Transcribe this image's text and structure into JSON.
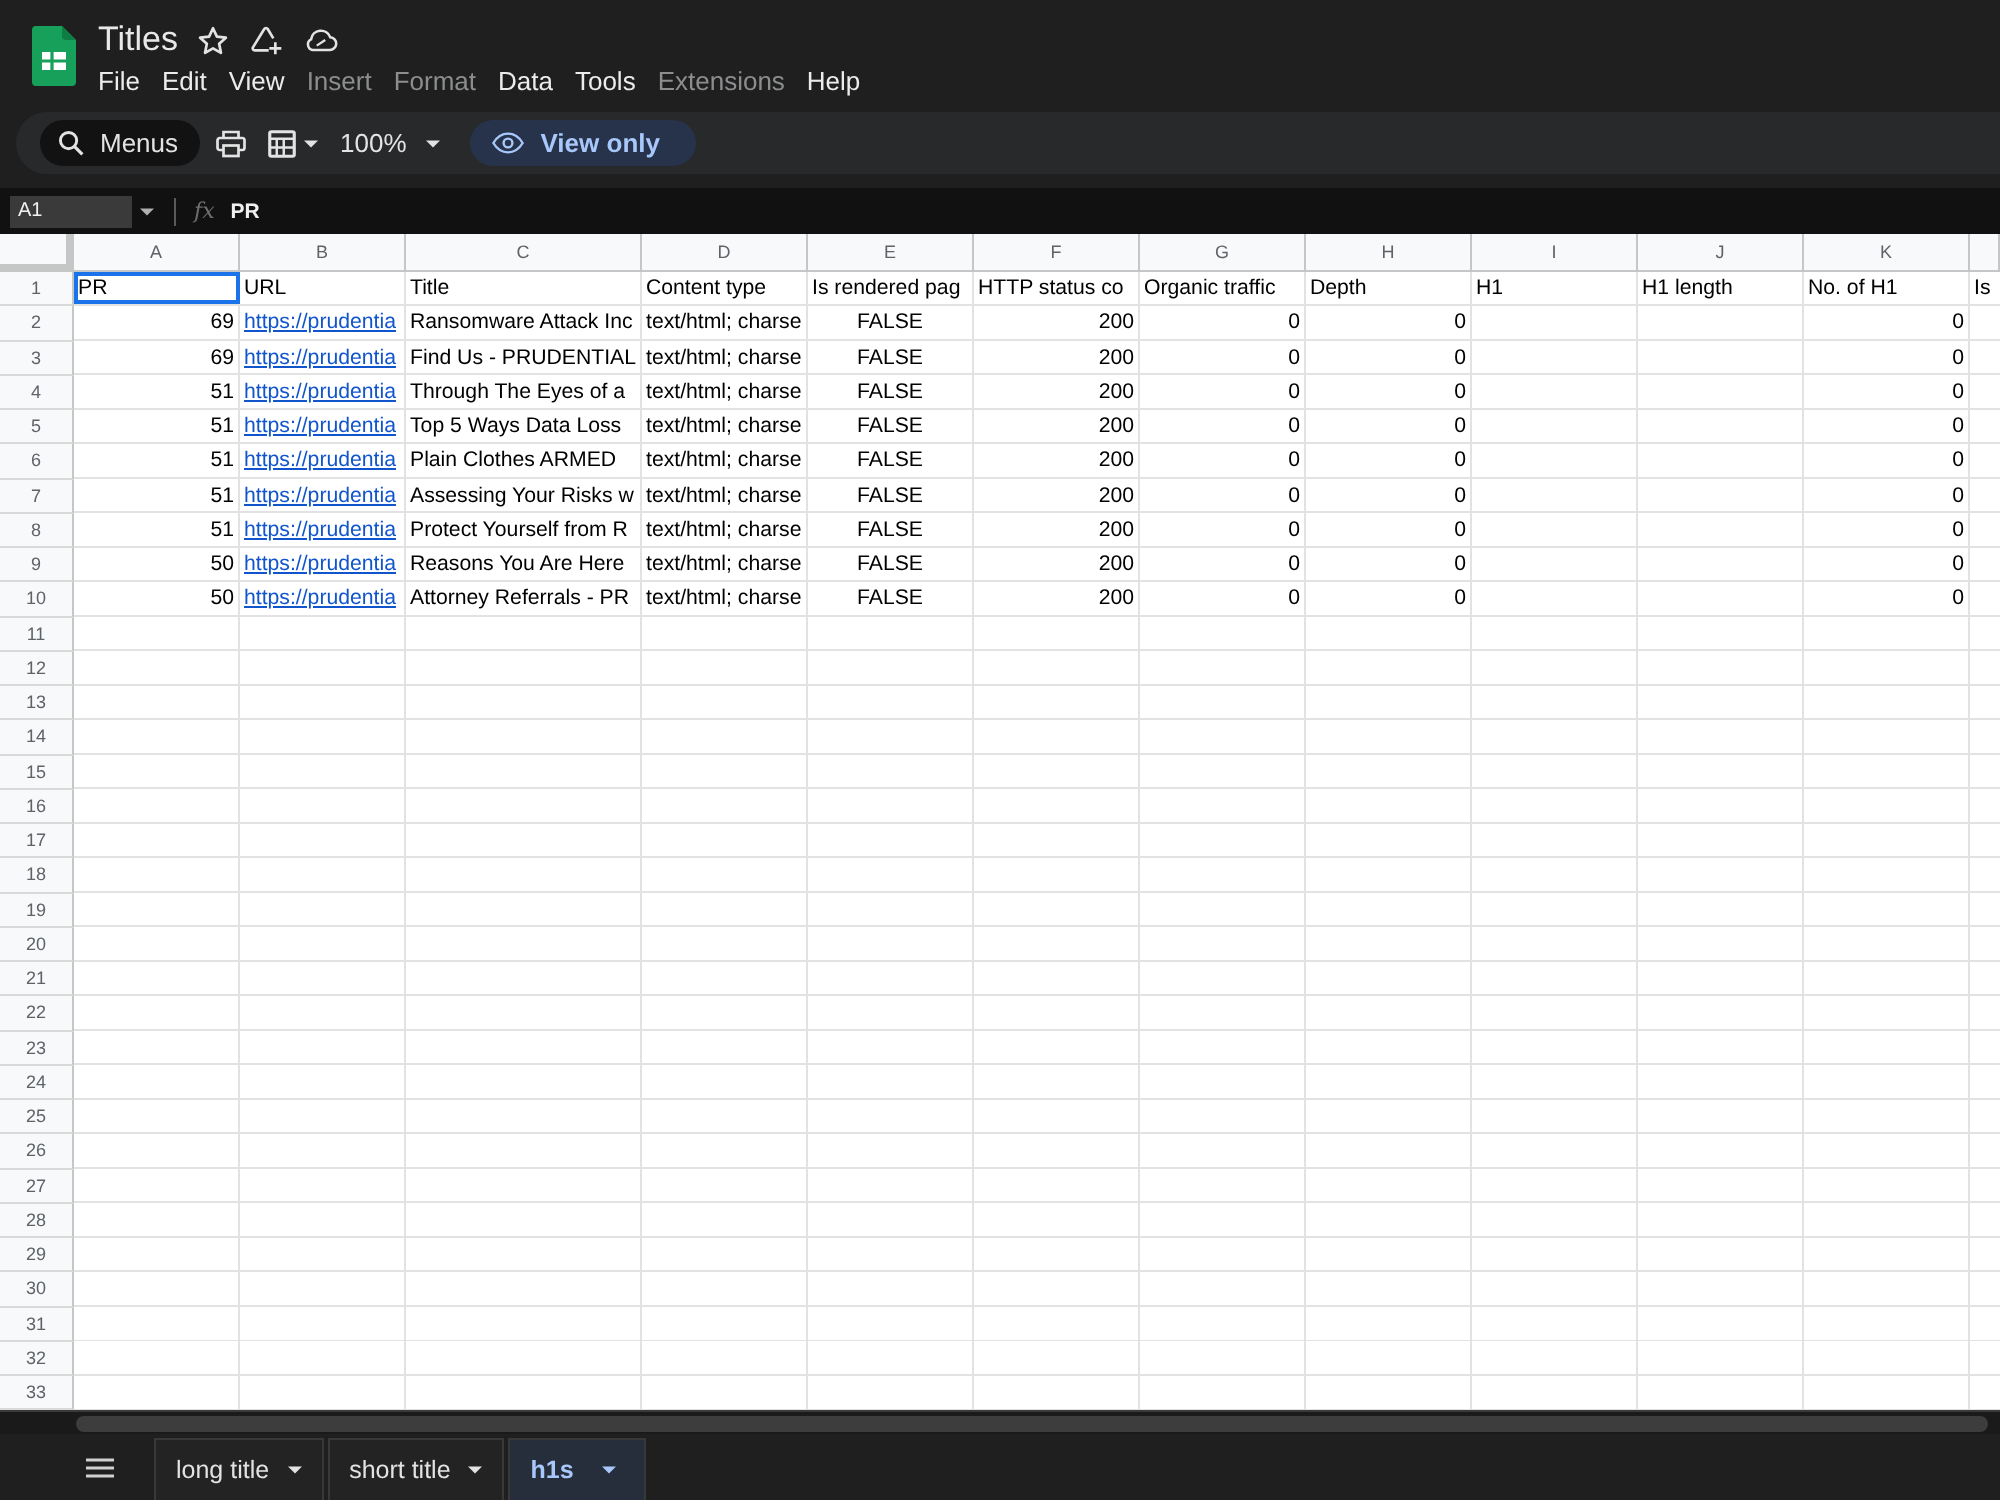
{
  "document": {
    "title": "Titles"
  },
  "menu_bar": [
    {
      "label": "File",
      "disabled": false
    },
    {
      "label": "Edit",
      "disabled": false
    },
    {
      "label": "View",
      "disabled": false
    },
    {
      "label": "Insert",
      "disabled": true
    },
    {
      "label": "Format",
      "disabled": true
    },
    {
      "label": "Data",
      "disabled": false
    },
    {
      "label": "Tools",
      "disabled": false
    },
    {
      "label": "Extensions",
      "disabled": true
    },
    {
      "label": "Help",
      "disabled": false
    }
  ],
  "toolbar": {
    "menus_search": {
      "label": "Menus"
    },
    "zoom": "100%",
    "mode_badge": "View only"
  },
  "formula_bar": {
    "cell_ref": "A1",
    "function_symbol": "fx",
    "content": "PR"
  },
  "sheet": {
    "columns": [
      "A",
      "B",
      "C",
      "D",
      "E",
      "F",
      "G",
      "H",
      "I",
      "J",
      "K"
    ],
    "rows": [
      {
        "number": "1",
        "cells": [
          {
            "text": "PR",
            "kind": "text",
            "selected": true
          },
          {
            "text": "URL",
            "kind": "text",
            "selected": false
          },
          {
            "text": "Title",
            "kind": "text",
            "selected": false
          },
          {
            "text": "Content type",
            "kind": "text",
            "selected": false
          },
          {
            "text": "Is rendered pag",
            "kind": "text",
            "selected": false
          },
          {
            "text": "HTTP status co",
            "kind": "text",
            "selected": false
          },
          {
            "text": "Organic traffic",
            "kind": "text",
            "selected": false
          },
          {
            "text": "Depth",
            "kind": "text",
            "selected": false
          },
          {
            "text": "H1",
            "kind": "text",
            "selected": false
          },
          {
            "text": "H1 length",
            "kind": "text",
            "selected": false
          },
          {
            "text": "No. of H1",
            "kind": "text",
            "selected": false
          },
          {
            "text": "Is",
            "kind": "text",
            "selected": false
          }
        ]
      },
      {
        "number": "2",
        "cells": [
          {
            "text": "69",
            "kind": "number",
            "selected": false
          },
          {
            "text": "https://prudentia",
            "kind": "link",
            "selected": false
          },
          {
            "text": "Ransomware Attack Inc",
            "kind": "text",
            "selected": false
          },
          {
            "text": "text/html; charse",
            "kind": "text",
            "selected": false
          },
          {
            "text": "FALSE",
            "kind": "boolean",
            "selected": false
          },
          {
            "text": "200",
            "kind": "number",
            "selected": false
          },
          {
            "text": "0",
            "kind": "number",
            "selected": false
          },
          {
            "text": "0",
            "kind": "number",
            "selected": false
          },
          {},
          {},
          {
            "text": "0",
            "kind": "number",
            "selected": false
          }
        ]
      },
      {
        "number": "3",
        "cells": [
          {
            "text": "69",
            "kind": "number",
            "selected": false
          },
          {
            "text": "https://prudentia",
            "kind": "link",
            "selected": false
          },
          {
            "text": "Find Us - PRUDENTIAL",
            "kind": "text",
            "selected": false
          },
          {
            "text": "text/html; charse",
            "kind": "text",
            "selected": false
          },
          {
            "text": "FALSE",
            "kind": "boolean",
            "selected": false
          },
          {
            "text": "200",
            "kind": "number",
            "selected": false
          },
          {
            "text": "0",
            "kind": "number",
            "selected": false
          },
          {
            "text": "0",
            "kind": "number",
            "selected": false
          },
          {},
          {},
          {
            "text": "0",
            "kind": "number",
            "selected": false
          }
        ]
      },
      {
        "number": "4",
        "cells": [
          {
            "text": "51",
            "kind": "number",
            "selected": false
          },
          {
            "text": "https://prudentia",
            "kind": "link",
            "selected": false
          },
          {
            "text": "Through The Eyes of a",
            "kind": "text",
            "selected": false
          },
          {
            "text": "text/html; charse",
            "kind": "text",
            "selected": false
          },
          {
            "text": "FALSE",
            "kind": "boolean",
            "selected": false
          },
          {
            "text": "200",
            "kind": "number",
            "selected": false
          },
          {
            "text": "0",
            "kind": "number",
            "selected": false
          },
          {
            "text": "0",
            "kind": "number",
            "selected": false
          },
          {},
          {},
          {
            "text": "0",
            "kind": "number",
            "selected": false
          }
        ]
      },
      {
        "number": "5",
        "cells": [
          {
            "text": "51",
            "kind": "number",
            "selected": false
          },
          {
            "text": "https://prudentia",
            "kind": "link",
            "selected": false
          },
          {
            "text": "Top 5 Ways Data Loss",
            "kind": "text",
            "selected": false
          },
          {
            "text": "text/html; charse",
            "kind": "text",
            "selected": false
          },
          {
            "text": "FALSE",
            "kind": "boolean",
            "selected": false
          },
          {
            "text": "200",
            "kind": "number",
            "selected": false
          },
          {
            "text": "0",
            "kind": "number",
            "selected": false
          },
          {
            "text": "0",
            "kind": "number",
            "selected": false
          },
          {},
          {},
          {
            "text": "0",
            "kind": "number",
            "selected": false
          }
        ]
      },
      {
        "number": "6",
        "cells": [
          {
            "text": "51",
            "kind": "number",
            "selected": false
          },
          {
            "text": "https://prudentia",
            "kind": "link",
            "selected": false
          },
          {
            "text": "Plain Clothes ARMED",
            "kind": "text",
            "selected": false
          },
          {
            "text": "text/html; charse",
            "kind": "text",
            "selected": false
          },
          {
            "text": "FALSE",
            "kind": "boolean",
            "selected": false
          },
          {
            "text": "200",
            "kind": "number",
            "selected": false
          },
          {
            "text": "0",
            "kind": "number",
            "selected": false
          },
          {
            "text": "0",
            "kind": "number",
            "selected": false
          },
          {},
          {},
          {
            "text": "0",
            "kind": "number",
            "selected": false
          }
        ]
      },
      {
        "number": "7",
        "cells": [
          {
            "text": "51",
            "kind": "number",
            "selected": false
          },
          {
            "text": "https://prudentia",
            "kind": "link",
            "selected": false
          },
          {
            "text": "Assessing Your Risks w",
            "kind": "text",
            "selected": false
          },
          {
            "text": "text/html; charse",
            "kind": "text",
            "selected": false
          },
          {
            "text": "FALSE",
            "kind": "boolean",
            "selected": false
          },
          {
            "text": "200",
            "kind": "number",
            "selected": false
          },
          {
            "text": "0",
            "kind": "number",
            "selected": false
          },
          {
            "text": "0",
            "kind": "number",
            "selected": false
          },
          {},
          {},
          {
            "text": "0",
            "kind": "number",
            "selected": false
          }
        ]
      },
      {
        "number": "8",
        "cells": [
          {
            "text": "51",
            "kind": "number",
            "selected": false
          },
          {
            "text": "https://prudentia",
            "kind": "link",
            "selected": false
          },
          {
            "text": "Protect Yourself from R",
            "kind": "text",
            "selected": false
          },
          {
            "text": "text/html; charse",
            "kind": "text",
            "selected": false
          },
          {
            "text": "FALSE",
            "kind": "boolean",
            "selected": false
          },
          {
            "text": "200",
            "kind": "number",
            "selected": false
          },
          {
            "text": "0",
            "kind": "number",
            "selected": false
          },
          {
            "text": "0",
            "kind": "number",
            "selected": false
          },
          {},
          {},
          {
            "text": "0",
            "kind": "number",
            "selected": false
          }
        ]
      },
      {
        "number": "9",
        "cells": [
          {
            "text": "50",
            "kind": "number",
            "selected": false
          },
          {
            "text": "https://prudentia",
            "kind": "link",
            "selected": false
          },
          {
            "text": "Reasons You Are Here",
            "kind": "text",
            "selected": false
          },
          {
            "text": "text/html; charse",
            "kind": "text",
            "selected": false
          },
          {
            "text": "FALSE",
            "kind": "boolean",
            "selected": false
          },
          {
            "text": "200",
            "kind": "number",
            "selected": false
          },
          {
            "text": "0",
            "kind": "number",
            "selected": false
          },
          {
            "text": "0",
            "kind": "number",
            "selected": false
          },
          {},
          {},
          {
            "text": "0",
            "kind": "number",
            "selected": false
          }
        ]
      },
      {
        "number": "10",
        "cells": [
          {
            "text": "50",
            "kind": "number",
            "selected": false
          },
          {
            "text": "https://prudentia",
            "kind": "link",
            "selected": false
          },
          {
            "text": "Attorney Referrals - PR",
            "kind": "text",
            "selected": false
          },
          {
            "text": "text/html; charse",
            "kind": "text",
            "selected": false
          },
          {
            "text": "FALSE",
            "kind": "boolean",
            "selected": false
          },
          {
            "text": "200",
            "kind": "number",
            "selected": false
          },
          {
            "text": "0",
            "kind": "number",
            "selected": false
          },
          {
            "text": "0",
            "kind": "number",
            "selected": false
          },
          {},
          {},
          {
            "text": "0",
            "kind": "number",
            "selected": false
          }
        ]
      },
      {
        "number": "11"
      },
      {
        "number": "12"
      },
      {
        "number": "13"
      },
      {
        "number": "14"
      },
      {
        "number": "15"
      },
      {
        "number": "16"
      },
      {
        "number": "17"
      },
      {
        "number": "18"
      },
      {
        "number": "19"
      },
      {
        "number": "20"
      },
      {
        "number": "21"
      },
      {
        "number": "22"
      },
      {
        "number": "23"
      },
      {
        "number": "24"
      },
      {
        "number": "25"
      },
      {
        "number": "26"
      },
      {
        "number": "27"
      },
      {
        "number": "28"
      },
      {
        "number": "29"
      },
      {
        "number": "30"
      },
      {
        "number": "31"
      },
      {
        "number": "32"
      },
      {
        "number": "33"
      }
    ]
  },
  "sheet_tabs": [
    {
      "label": "long title",
      "selected": false
    },
    {
      "label": "short title",
      "selected": false
    },
    {
      "label": "h1s",
      "selected": true
    }
  ]
}
